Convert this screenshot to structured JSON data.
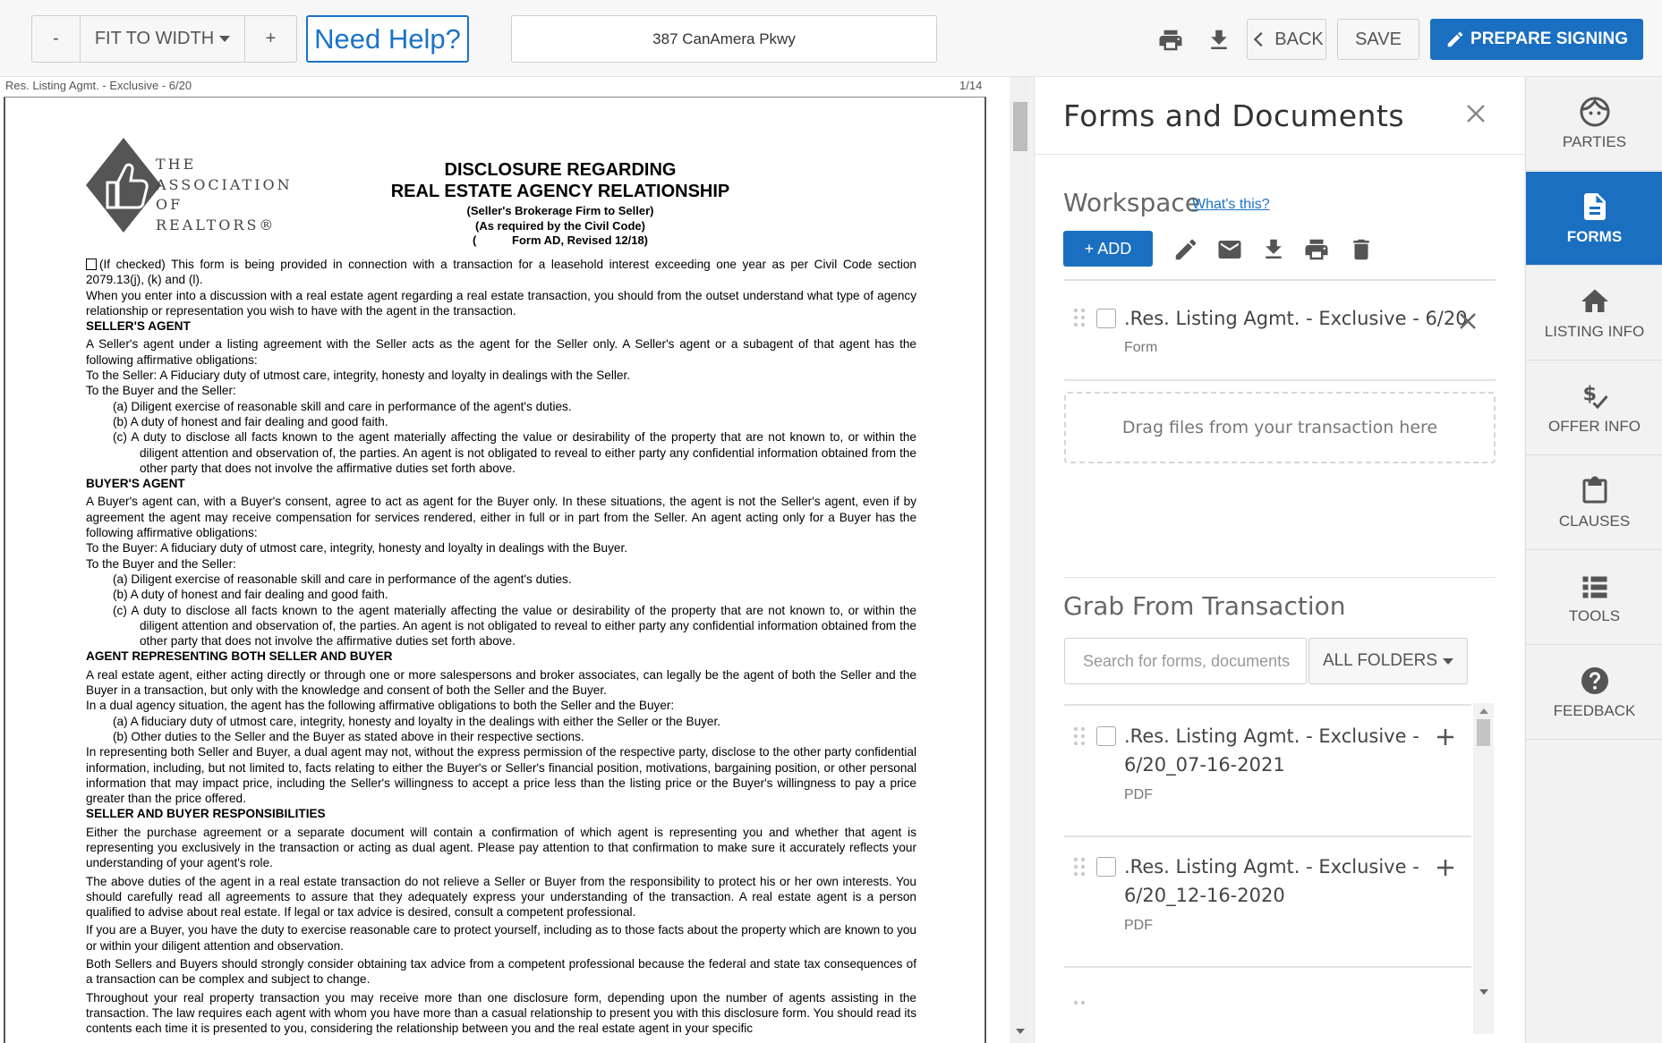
{
  "toolbar": {
    "zoom_out": "-",
    "fit_label": "FIT TO WIDTH",
    "zoom_in": "+",
    "help_label": "Need Help?",
    "address": "387 CanAmera Pkwy",
    "back_label": "BACK",
    "save_label": "SAVE",
    "prepare_label": "PREPARE SIGNING",
    "accent": "#1a6fc0"
  },
  "document": {
    "header_left": "Res. Listing Agmt. - Exclusive - 6/20",
    "header_right": "1/14",
    "logo": [
      "THE",
      "ASSOCIATION",
      "OF REALTORS®"
    ],
    "title1": "DISCLOSURE REGARDING",
    "title2": "REAL ESTATE AGENCY RELATIONSHIP",
    "sub1": "(Seller's Brokerage Firm to Seller)",
    "sub2": "(As required by the Civil Code)",
    "sub3": "(           Form AD, Revised 12/18)",
    "paras": [
      "(If checked) This form is being provided in connection with a transaction for a leasehold interest exceeding one year as per Civil Code section 2079.13(j), (k) and (l).",
      "When you enter into a discussion with a real estate agent regarding a real estate transaction, you should from the outset understand what type of agency relationship or representation you wish to have with the agent in the transaction.",
      "SELLER'S AGENT",
      "A Seller's agent under a listing agreement with the Seller acts as the agent for the Seller only. A Seller's agent or a subagent of that agent has the following affirmative obligations:",
      "To the Seller: A Fiduciary duty of utmost care, integrity, honesty and loyalty in dealings with the Seller.",
      "To the Buyer and the Seller:",
      "(a)   Diligent exercise of reasonable skill and care in performance of the agent's duties.",
      "(b)   A duty of honest and fair dealing and good faith.",
      "(c)   A duty to disclose all facts known to the agent materially affecting the value or desirability of the property that are not known to, or within the diligent attention and observation of, the parties. An agent is not obligated to reveal to either party any confidential information obtained from the other party that does not involve the affirmative duties set forth above.",
      "BUYER'S AGENT",
      "A Buyer's agent can, with a Buyer's consent, agree to act as agent for the Buyer only. In these situations, the agent is not the Seller's agent, even if by agreement the agent may receive compensation for services rendered, either in full or in part from the Seller. An agent acting only for a Buyer has the following affirmative obligations:",
      "To the Buyer: A fiduciary duty of utmost care, integrity, honesty and loyalty in dealings with the Buyer.",
      "To the Buyer and the Seller:",
      "(a)   Diligent exercise of reasonable skill and care in performance of the agent's duties.",
      "(b)   A duty of honest and fair dealing and good faith.",
      "(c)   A duty to disclose all facts known to the agent materially affecting the value or desirability of the property that are not known to, or within the diligent attention and observation of, the parties. An agent is not obligated to reveal to either party any confidential information obtained from the other party that does not involve the affirmative duties set forth above.",
      "AGENT REPRESENTING BOTH SELLER AND BUYER",
      "A real estate agent, either acting directly or through one or more salespersons and broker associates, can legally be the agent of both the Seller and the Buyer in a transaction, but only with the knowledge and consent of both the Seller and the Buyer.",
      "In a dual agency situation, the agent has the following affirmative obligations to both the Seller and the Buyer:",
      "(a)   A fiduciary duty of utmost care, integrity, honesty and loyalty in the dealings with either the Seller or the Buyer.",
      "(b)   Other duties to the Seller and the Buyer as stated above in their respective sections.",
      "In representing both Seller and Buyer, a dual agent may not, without the express permission of the respective party, disclose to the other party confidential information, including, but not limited to, facts relating to either the Buyer's or Seller's financial position, motivations, bargaining position, or other personal information that may impact price, including the Seller's willingness to accept a price less than the listing price or the Buyer's willingness to pay a price greater than the price offered.",
      "SELLER AND BUYER RESPONSIBILITIES",
      "Either the purchase agreement or a separate document will contain a confirmation of which agent is representing you and whether that agent is representing you exclusively in the transaction or acting as dual agent. Please pay attention to that confirmation to make sure it accurately reflects your understanding of your agent's role.",
      "The above duties of the agent in a real estate transaction do not relieve a Seller or Buyer from the responsibility to protect his or her own interests. You should carefully read all agreements to assure that they adequately express your understanding of the transaction. A real estate agent is a person qualified to advise about real estate. If legal or tax advice is desired, consult a competent professional.",
      "If you are a Buyer, you have the duty to exercise reasonable care to protect yourself, including as to those facts about the property which are known to you or within your diligent attention and observation.",
      "Both Sellers and Buyers should strongly consider obtaining tax advice from a competent professional because the federal and state tax consequences of a transaction can be complex and subject to change.",
      "Throughout your real property transaction you may receive more than one disclosure form, depending upon the number of agents assisting in the transaction. The law requires each agent with whom you have more than a casual relationship to present you with this disclosure form. You should read its contents each time it is presented to you, considering the relationship between you and the real estate agent in your specific"
    ]
  },
  "panel": {
    "title": "Forms and Documents",
    "workspace_title": "Workspace",
    "whats_this": "What's this?",
    "add_label": "+ ADD",
    "workspace_item": {
      "name": ".Res. Listing Agmt. - Exclusive - 6/20",
      "type": "Form"
    },
    "dropzone": "Drag files from your transaction here",
    "grab_title": "Grab From Transaction",
    "search_placeholder": "Search for forms, documents",
    "folders_label": "ALL FOLDERS",
    "items": [
      {
        "line1": ".Res. Listing Agmt. - Exclusive -",
        "line2": "6/20_07-16-2021",
        "type": "PDF"
      },
      {
        "line1": ".Res. Listing Agmt. - Exclusive -",
        "line2": "6/20_12-16-2020",
        "type": "PDF"
      }
    ]
  },
  "sidebar": {
    "items": [
      {
        "label": "PARTIES",
        "icon": "face-icon"
      },
      {
        "label": "FORMS",
        "icon": "document-icon"
      },
      {
        "label": "LISTING INFO",
        "icon": "home-icon"
      },
      {
        "label": "OFFER INFO",
        "icon": "dollar-check-icon"
      },
      {
        "label": "CLAUSES",
        "icon": "clipboard-icon"
      },
      {
        "label": "TOOLS",
        "icon": "list-icon"
      },
      {
        "label": "FEEDBACK",
        "icon": "question-icon"
      }
    ]
  }
}
